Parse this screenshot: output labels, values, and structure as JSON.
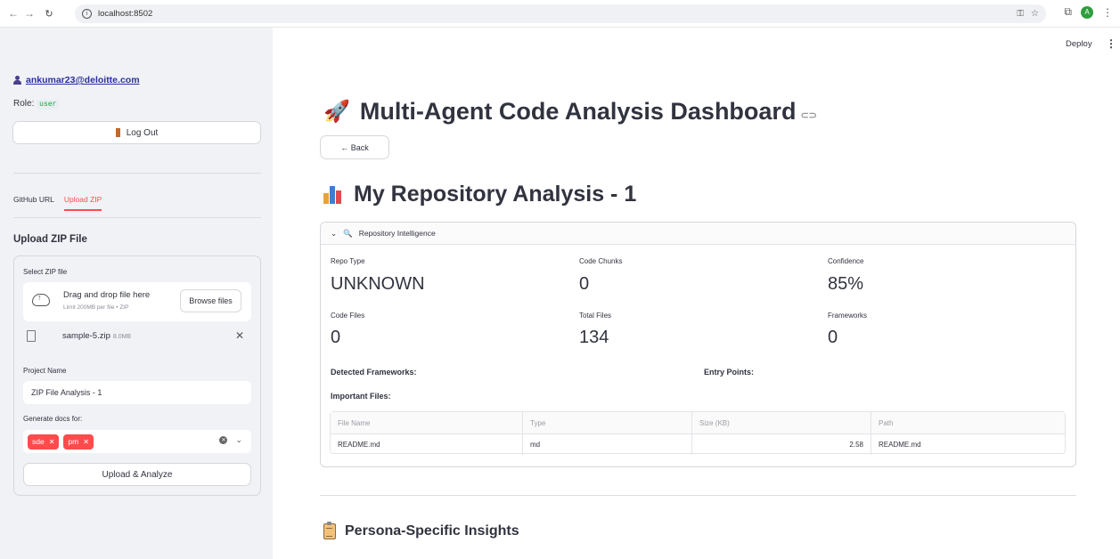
{
  "browser": {
    "url": "localhost:8502",
    "profile_initial": "A"
  },
  "sidebar": {
    "user_email": "ankumar23@deloitte.com",
    "role_label": "Role:",
    "role_value": "user",
    "logout_label": "Log Out",
    "tabs": [
      {
        "label": "GitHub URL",
        "active": false
      },
      {
        "label": "Upload ZIP",
        "active": true
      }
    ],
    "upload_heading": "Upload ZIP File",
    "uploader": {
      "label": "Select ZIP file",
      "drag_text": "Drag and drop file here",
      "limit_text": "Limit 200MB per file • ZIP",
      "browse_label": "Browse files",
      "file_name": "sample-5.zip",
      "file_size": "8.0MB"
    },
    "project_name_label": "Project Name",
    "project_name_value": "ZIP File Analysis - 1",
    "docs_label": "Generate docs for:",
    "docs_tags": [
      "sde",
      "pm"
    ],
    "upload_button": "Upload & Analyze"
  },
  "header": {
    "deploy_label": "Deploy"
  },
  "main": {
    "title": "Multi-Agent Code Analysis Dashboard",
    "back_label": "← Back",
    "subtitle": "My Repository Analysis - 1",
    "expander_title": "Repository Intelligence",
    "metrics": [
      {
        "label": "Repo Type",
        "value": "UNKNOWN"
      },
      {
        "label": "Code Chunks",
        "value": "0"
      },
      {
        "label": "Confidence",
        "value": "85%"
      },
      {
        "label": "Code Files",
        "value": "0"
      },
      {
        "label": "Total Files",
        "value": "134"
      },
      {
        "label": "Frameworks",
        "value": "0"
      }
    ],
    "detected_frameworks_label": "Detected Frameworks:",
    "entry_points_label": "Entry Points:",
    "important_files_label": "Important Files:",
    "table": {
      "headers": [
        "File Name",
        "Type",
        "Size (KB)",
        "Path"
      ],
      "rows": [
        [
          "README.md",
          "md",
          "2.58",
          "README.md"
        ]
      ]
    },
    "persona_heading": "Persona-Specific Insights"
  },
  "colors": {
    "accent": "#ff4b4b",
    "sidebar_bg": "#f0f2f6",
    "text": "#31333f"
  }
}
